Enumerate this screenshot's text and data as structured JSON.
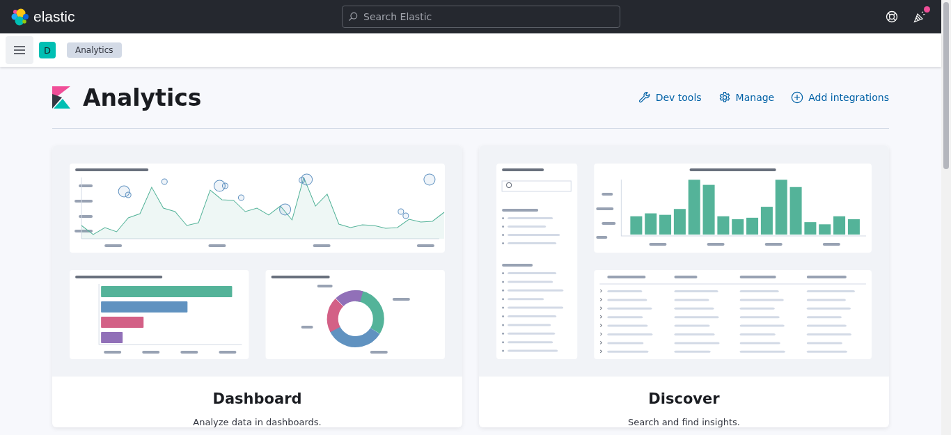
{
  "header": {
    "logo_text": "elastic",
    "search": {
      "placeholder": "Search Elastic"
    },
    "news_unread": true
  },
  "breadcrumbs": {
    "space_initial": "D",
    "items": [
      {
        "label": "Analytics"
      }
    ]
  },
  "page": {
    "title": "Analytics",
    "actions": [
      {
        "label": "Dev tools",
        "kind": "wrench"
      },
      {
        "label": "Manage",
        "kind": "gear"
      },
      {
        "label": "Add integrations",
        "kind": "plus"
      }
    ]
  },
  "cards": [
    {
      "kind": "dashboard",
      "title": "Dashboard",
      "description": "Analyze data in dashboards."
    },
    {
      "kind": "discover",
      "title": "Discover",
      "description": "Search and find insights."
    }
  ]
}
